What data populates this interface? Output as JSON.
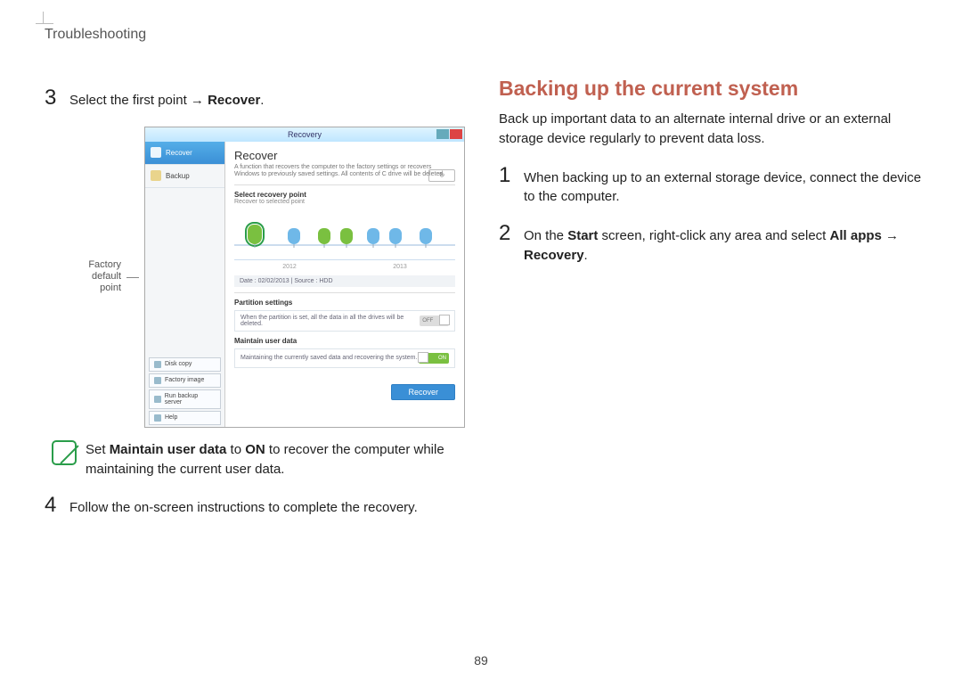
{
  "header": {
    "section": "Troubleshooting"
  },
  "left": {
    "step3": {
      "num": "3",
      "t1": "Select the first point ",
      "arrow": "→",
      "t2": " ",
      "bold": "Recover",
      "t3": "."
    },
    "callout": {
      "l1": "Factory",
      "l2": "default",
      "l3": "point"
    },
    "note": {
      "t1": "Set ",
      "b1": "Maintain user data",
      "t2": " to ",
      "b2": "ON",
      "t3": " to recover the computer while maintaining the current user data."
    },
    "step4": {
      "num": "4",
      "text": "Follow the on-screen instructions to complete the recovery."
    }
  },
  "right": {
    "heading": "Backing up the current system",
    "para": "Back up important data to an alternate internal drive or an external storage device regularly to prevent data loss.",
    "step1": {
      "num": "1",
      "text": "When backing up to an external storage device, connect the device to the computer."
    },
    "step2": {
      "num": "2",
      "t1": "On the ",
      "b1": "Start",
      "t2": " screen, right-click any area and select ",
      "b2": "All apps",
      "t3": " ",
      "arrow": "→",
      "t4": " ",
      "b3": "Recovery",
      "t5": "."
    }
  },
  "shot": {
    "title": "Recovery",
    "sidebar": {
      "recover": "Recover",
      "backup": "Backup",
      "disk_copy": "Disk copy",
      "factory_image": "Factory image",
      "run_backup": "Run backup server",
      "help": "Help"
    },
    "main": {
      "title": "Recover",
      "desc": "A function that recovers the computer to the factory settings or recovers Windows to previously saved settings. All contents of C drive will be deleted.",
      "select_label": "Select recovery point",
      "select_sub": "Recover to selected point",
      "refresh_icon": "↻",
      "year1": "2012",
      "year2": "2013",
      "date_row": "Date : 02/02/2013   |   Source : HDD",
      "partition_label": "Partition settings",
      "partition_text": "When the partition is set, all the data in all the drives will be deleted.",
      "maintain_label": "Maintain user data",
      "maintain_text": "Maintaining the currently saved data and recovering the system.",
      "off": "OFF",
      "on": "ON",
      "recover_btn": "Recover"
    }
  },
  "page_number": "89"
}
